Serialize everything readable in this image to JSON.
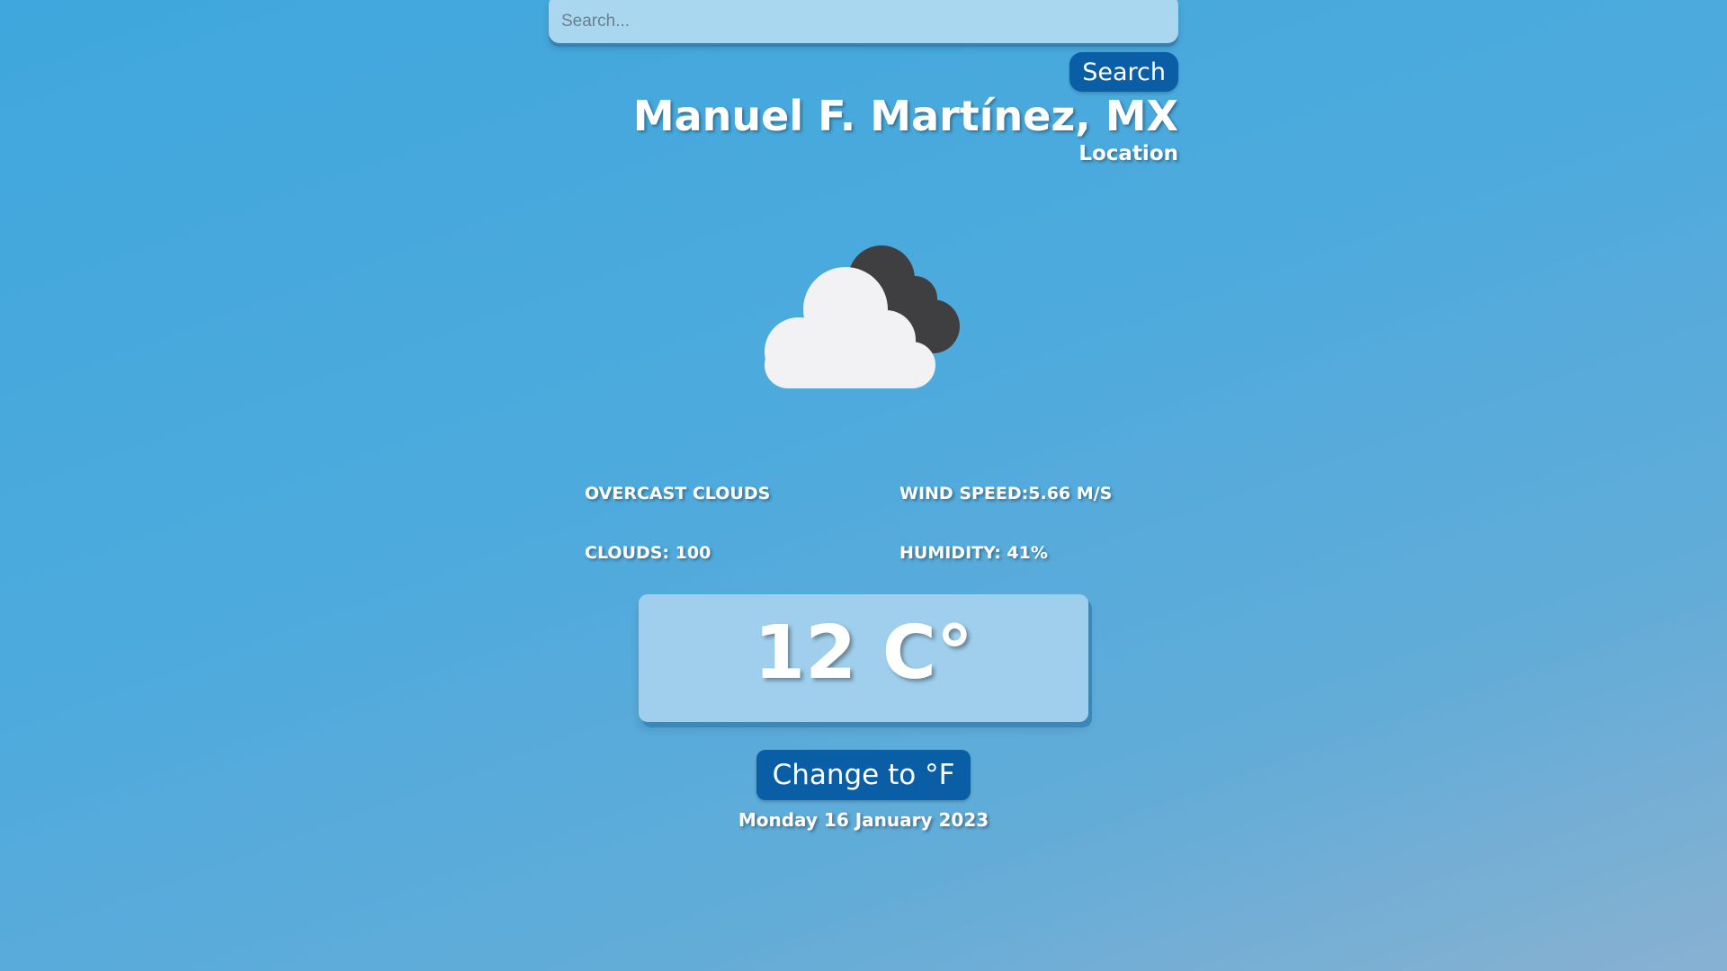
{
  "search": {
    "placeholder": "Search...",
    "value": "",
    "button_label": "Search"
  },
  "location": {
    "name": "Manuel F. Martínez, MX",
    "label": "Location"
  },
  "weather": {
    "icon": "cloud-icon",
    "description": "OVERCAST CLOUDS",
    "wind_speed": "WIND SPEED:5.66 M/S",
    "clouds": "CLOUDS: 100",
    "humidity": "HUMIDITY: 41%"
  },
  "temperature": {
    "display": "12 C°"
  },
  "unit_toggle": {
    "label": "Change to °F"
  },
  "date": "Monday 16 January 2023",
  "colors": {
    "button": "#0a5ea6",
    "card": "#9fcfec",
    "search_bg": "#a8d7ef",
    "cloud_light": "#f2f2f4",
    "cloud_dark": "#3f3f42"
  }
}
